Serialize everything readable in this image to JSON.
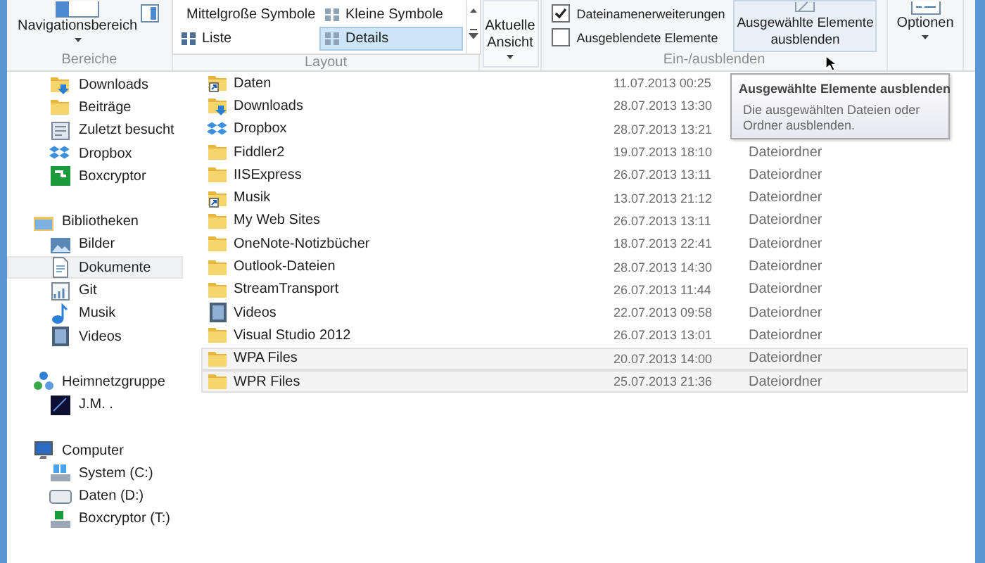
{
  "ribbon": {
    "groups": [
      {
        "kind": "panes",
        "label": "Bereiche",
        "button": {
          "label": "Navigationsbereich"
        }
      },
      {
        "kind": "layout",
        "label": "Layout",
        "options": [
          {
            "label": "Mittelgroße Symbole",
            "selected": false
          },
          {
            "label": "Kleine Symbole",
            "selected": false
          },
          {
            "label": "Liste",
            "selected": false
          },
          {
            "label": "Details",
            "selected": true
          }
        ]
      },
      {
        "kind": "current_view",
        "button": {
          "label": "Aktuelle Ansicht"
        }
      },
      {
        "kind": "show_hide",
        "label": "Ein-/ausblenden",
        "checkboxes": [
          {
            "label": "Dateinamenerweiterungen",
            "checked": true
          },
          {
            "label": "Ausgeblendete Elemente",
            "checked": false
          }
        ],
        "button": {
          "label": "Ausgewählte Elemente ausblenden",
          "hovered": true
        }
      },
      {
        "kind": "options",
        "button": {
          "label": "Optionen"
        }
      }
    ]
  },
  "sidebar": {
    "sections": [
      {
        "children": [
          {
            "label": "Downloads",
            "kind": "downloads",
            "selected": false
          },
          {
            "label": "Beiträge",
            "kind": "folder",
            "selected": false
          },
          {
            "label": "Zuletzt besucht",
            "kind": "recent",
            "selected": false
          },
          {
            "label": "Dropbox",
            "kind": "dropbox",
            "selected": false
          },
          {
            "label": "Boxcryptor",
            "kind": "boxcryptor",
            "selected": false
          }
        ]
      },
      {
        "label": "Bibliotheken",
        "kind": "library",
        "selected": false,
        "children": [
          {
            "label": "Bilder",
            "kind": "pictures",
            "selected": false
          },
          {
            "label": "Dokumente",
            "kind": "documents",
            "selected": true
          },
          {
            "label": "Git",
            "kind": "git",
            "selected": false
          },
          {
            "label": "Musik",
            "kind": "music",
            "selected": false
          },
          {
            "label": "Videos",
            "kind": "videos",
            "selected": false
          }
        ]
      },
      {
        "label": "Heimnetzgruppe",
        "kind": "homegroup",
        "selected": false,
        "children": [
          {
            "label": "J.M. .",
            "kind": "user",
            "selected": false
          }
        ]
      },
      {
        "label": "Computer",
        "kind": "computer",
        "selected": false,
        "children": [
          {
            "label": "System (C:)",
            "kind": "system_drive",
            "selected": false
          },
          {
            "label": "Daten (D:)",
            "kind": "drive",
            "selected": false
          },
          {
            "label": "Boxcryptor (T:)",
            "kind": "boxcryptor_drive",
            "selected": false
          }
        ]
      }
    ]
  },
  "files": {
    "rows": [
      {
        "name": "Daten",
        "kind": "shortcut",
        "date": "11.07.2013 00:25",
        "selected": false
      },
      {
        "name": "Downloads",
        "kind": "downloads",
        "date": "28.07.2013 13:30",
        "selected": false
      },
      {
        "name": "Dropbox",
        "kind": "dropbox",
        "date": "28.07.2013 13:21",
        "selected": false
      },
      {
        "name": "Fiddler2",
        "kind": "folder",
        "date": "19.07.2013 18:10",
        "type": "Dateiordner",
        "selected": false
      },
      {
        "name": "IISExpress",
        "kind": "folder",
        "date": "26.07.2013 13:11",
        "type": "Dateiordner",
        "selected": false
      },
      {
        "name": "Musik",
        "kind": "shortcut",
        "date": "13.07.2013 21:12",
        "type": "Dateiordner",
        "selected": false
      },
      {
        "name": "My Web Sites",
        "kind": "folder",
        "date": "26.07.2013 13:11",
        "type": "Dateiordner",
        "selected": false
      },
      {
        "name": "OneNote-Notizbücher",
        "kind": "folder",
        "date": "18.07.2013 22:41",
        "type": "Dateiordner",
        "selected": false
      },
      {
        "name": "Outlook-Dateien",
        "kind": "folder",
        "date": "28.07.2013 14:30",
        "type": "Dateiordner",
        "selected": false
      },
      {
        "name": "StreamTransport",
        "kind": "folder",
        "date": "26.07.2013 11:44",
        "type": "Dateiordner",
        "selected": false
      },
      {
        "name": "Videos",
        "kind": "videos",
        "date": "22.07.2013 09:58",
        "type": "Dateiordner",
        "selected": false
      },
      {
        "name": "Visual Studio 2012",
        "kind": "folder",
        "date": "26.07.2013 13:01",
        "type": "Dateiordner",
        "selected": false
      },
      {
        "name": "WPA Files",
        "kind": "folder",
        "date": "20.07.2013 14:00",
        "type": "Dateiordner",
        "selected": true
      },
      {
        "name": "WPR Files",
        "kind": "folder",
        "date": "25.07.2013 21:36",
        "type": "Dateiordner",
        "selected": true
      }
    ]
  },
  "tooltip": {
    "title": "Ausgewählte Elemente ausblenden",
    "text": "Die ausgewählten Dateien oder Ordner ausblenden."
  }
}
